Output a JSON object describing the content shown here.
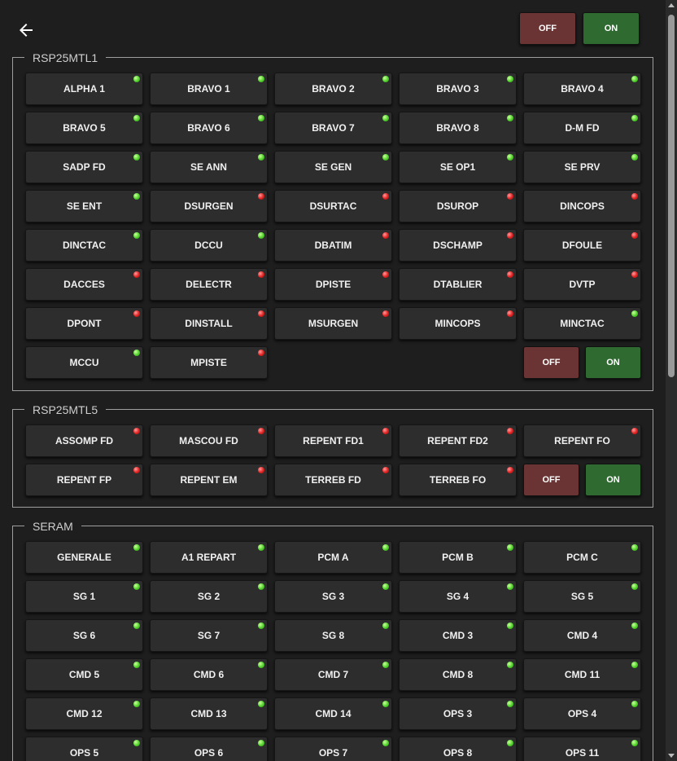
{
  "topbar": {
    "off_label": "OFF",
    "on_label": "ON"
  },
  "groups": [
    {
      "title": "RSP25MTL1",
      "tiles": [
        {
          "label": "ALPHA 1",
          "status": "green"
        },
        {
          "label": "BRAVO 1",
          "status": "green"
        },
        {
          "label": "BRAVO 2",
          "status": "green"
        },
        {
          "label": "BRAVO 3",
          "status": "green"
        },
        {
          "label": "BRAVO 4",
          "status": "green"
        },
        {
          "label": "BRAVO 5",
          "status": "green"
        },
        {
          "label": "BRAVO 6",
          "status": "green"
        },
        {
          "label": "BRAVO 7",
          "status": "green"
        },
        {
          "label": "BRAVO 8",
          "status": "green"
        },
        {
          "label": "D-M FD",
          "status": "green"
        },
        {
          "label": "SADP FD",
          "status": "green"
        },
        {
          "label": "SE ANN",
          "status": "green"
        },
        {
          "label": "SE GEN",
          "status": "green"
        },
        {
          "label": "SE OP1",
          "status": "green"
        },
        {
          "label": "SE PRV",
          "status": "green"
        },
        {
          "label": "SE ENT",
          "status": "green"
        },
        {
          "label": "DSURGEN",
          "status": "red"
        },
        {
          "label": "DSURTAC",
          "status": "red"
        },
        {
          "label": "DSUROP",
          "status": "red"
        },
        {
          "label": "DINCOPS",
          "status": "red"
        },
        {
          "label": "DINCTAC",
          "status": "green"
        },
        {
          "label": "DCCU",
          "status": "green"
        },
        {
          "label": "DBATIM",
          "status": "red"
        },
        {
          "label": "DSCHAMP",
          "status": "red"
        },
        {
          "label": "DFOULE",
          "status": "red"
        },
        {
          "label": "DACCES",
          "status": "red"
        },
        {
          "label": "DELECTR",
          "status": "red"
        },
        {
          "label": "DPISTE",
          "status": "red"
        },
        {
          "label": "DTABLIER",
          "status": "red"
        },
        {
          "label": "DVTP",
          "status": "red"
        },
        {
          "label": "DPONT",
          "status": "red"
        },
        {
          "label": "DINSTALL",
          "status": "red"
        },
        {
          "label": "MSURGEN",
          "status": "red"
        },
        {
          "label": "MINCOPS",
          "status": "red"
        },
        {
          "label": "MINCTAC",
          "status": "green"
        },
        {
          "label": "MCCU",
          "status": "green"
        },
        {
          "label": "MPISTE",
          "status": "red"
        }
      ],
      "off_label": "OFF",
      "on_label": "ON"
    },
    {
      "title": "RSP25MTL5",
      "tiles": [
        {
          "label": "ASSOMP FD",
          "status": "red"
        },
        {
          "label": "MASCOU FD",
          "status": "red"
        },
        {
          "label": "REPENT FD1",
          "status": "red"
        },
        {
          "label": "REPENT FD2",
          "status": "red"
        },
        {
          "label": "REPENT FO",
          "status": "red"
        },
        {
          "label": "REPENT FP",
          "status": "red"
        },
        {
          "label": "REPENT EM",
          "status": "red"
        },
        {
          "label": "TERREB FD",
          "status": "red"
        },
        {
          "label": "TERREB FO",
          "status": "red"
        }
      ],
      "off_label": "OFF",
      "on_label": "ON"
    },
    {
      "title": "SERAM",
      "tiles": [
        {
          "label": "GENERALE",
          "status": "green"
        },
        {
          "label": "A1 REPART",
          "status": "green"
        },
        {
          "label": "PCM A",
          "status": "green"
        },
        {
          "label": "PCM B",
          "status": "green"
        },
        {
          "label": "PCM C",
          "status": "green"
        },
        {
          "label": "SG 1",
          "status": "green"
        },
        {
          "label": "SG 2",
          "status": "green"
        },
        {
          "label": "SG 3",
          "status": "green"
        },
        {
          "label": "SG 4",
          "status": "green"
        },
        {
          "label": "SG 5",
          "status": "green"
        },
        {
          "label": "SG 6",
          "status": "green"
        },
        {
          "label": "SG 7",
          "status": "green"
        },
        {
          "label": "SG 8",
          "status": "green"
        },
        {
          "label": "CMD 3",
          "status": "green"
        },
        {
          "label": "CMD 4",
          "status": "green"
        },
        {
          "label": "CMD 5",
          "status": "green"
        },
        {
          "label": "CMD 6",
          "status": "green"
        },
        {
          "label": "CMD 7",
          "status": "green"
        },
        {
          "label": "CMD 8",
          "status": "green"
        },
        {
          "label": "CMD 11",
          "status": "green"
        },
        {
          "label": "CMD 12",
          "status": "green"
        },
        {
          "label": "CMD 13",
          "status": "green"
        },
        {
          "label": "CMD 14",
          "status": "green"
        },
        {
          "label": "OPS 3",
          "status": "green"
        },
        {
          "label": "OPS 4",
          "status": "green"
        },
        {
          "label": "OPS 5",
          "status": "green"
        },
        {
          "label": "OPS 6",
          "status": "green"
        },
        {
          "label": "OPS 7",
          "status": "green"
        },
        {
          "label": "OPS 8",
          "status": "green"
        },
        {
          "label": "OPS 11",
          "status": "green"
        }
      ]
    }
  ],
  "colors": {
    "background": "#1e1e1e",
    "tile": "#2d2d2d",
    "off": "#6b3434",
    "on": "#2f6b31",
    "led_green": "#4fd12a",
    "led_red": "#e02020"
  }
}
